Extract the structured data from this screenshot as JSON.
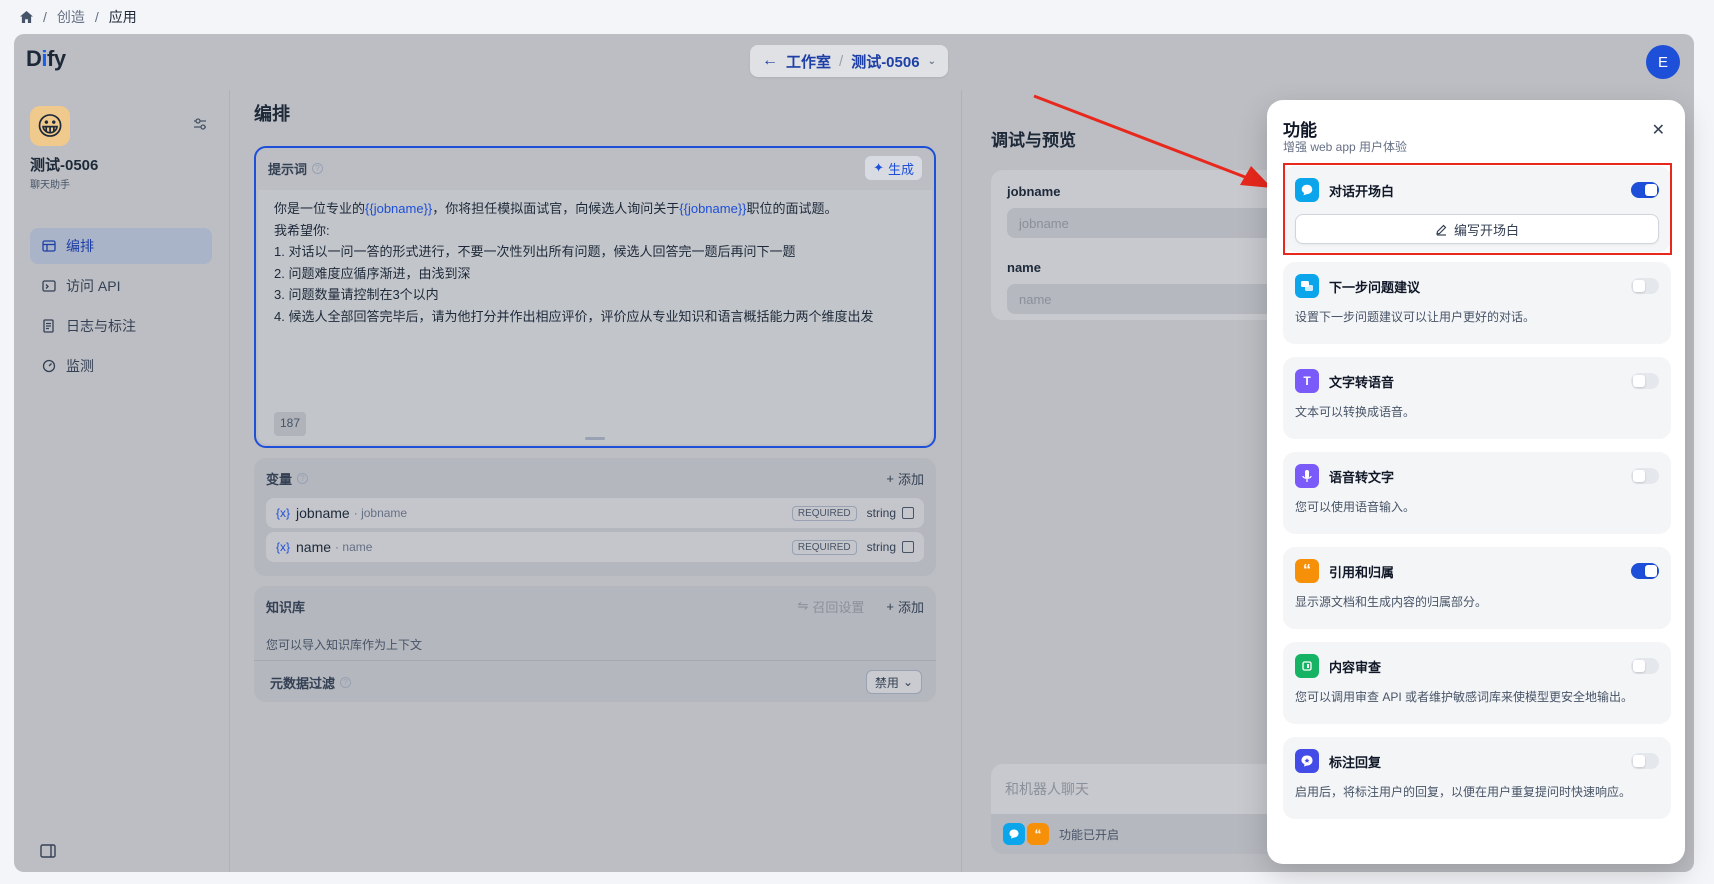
{
  "breadcrumb": {
    "sep": "/",
    "items": [
      "创造",
      "应用"
    ]
  },
  "app": {
    "logo_pre": "D",
    "logo_mid": "i",
    "logo_post": "fy",
    "top_crumb": {
      "studio": "工作室",
      "app": "测试-0506"
    },
    "user_initial": "E"
  },
  "sidebar": {
    "app_name": "测试-0506",
    "app_type": "聊天助手",
    "items": [
      {
        "label": "编排",
        "icon": "layout-icon"
      },
      {
        "label": "访问 API",
        "icon": "terminal-icon"
      },
      {
        "label": "日志与标注",
        "icon": "document-icon"
      },
      {
        "label": "监测",
        "icon": "gauge-icon"
      }
    ]
  },
  "main": {
    "title": "编排",
    "prompt": {
      "label": "提示词",
      "generate": "生成",
      "lines": [
        {
          "a": "你是一位专业的",
          "v1": "{{jobname}}",
          "b": "，你将担任模拟面试官，向候选人询问关于",
          "v2": "{{jobname}}",
          "c": "职位的面试题。"
        },
        "我希望你:",
        "1. 对话以一问一答的形式进行，不要一次性列出所有问题，候选人回答完一题后再问下一题",
        "2. 问题难度应循序渐进，由浅到深",
        "3. 问题数量请控制在3个以内",
        "4. 候选人全部回答完毕后，请为他打分并作出相应评价，评价应从专业知识和语言概括能力两个维度出发"
      ],
      "char_count": "187"
    },
    "variables": {
      "label": "变量",
      "add": "添加",
      "items": [
        {
          "name": "jobname",
          "key": "jobname",
          "required": "REQUIRED",
          "type": "string"
        },
        {
          "name": "name",
          "key": "name",
          "required": "REQUIRED",
          "type": "string"
        }
      ]
    },
    "knowledge": {
      "label": "知识库",
      "recall": "召回设置",
      "add": "添加",
      "desc": "您可以导入知识库作为上下文",
      "metadata_label": "元数据过滤",
      "metadata_value": "禁用"
    }
  },
  "debug": {
    "title": "调试与预览",
    "fields": [
      {
        "label": "jobname",
        "placeholder": "jobname"
      },
      {
        "label": "name",
        "placeholder": "name"
      }
    ],
    "chat_placeholder": "和机器人聊天",
    "features_enabled": "功能已开启"
  },
  "features": {
    "title": "功能",
    "subtitle": "增强 web app 用户体验",
    "items": [
      {
        "name": "对话开场白",
        "desc": "",
        "enabled": true,
        "color": "#0ba5ec",
        "action": "编写开场白"
      },
      {
        "name": "下一步问题建议",
        "desc": "设置下一步问题建议可以让用户更好的对话。",
        "enabled": false,
        "color": "#0ba5ec"
      },
      {
        "name": "文字转语音",
        "desc": "文本可以转换成语音。",
        "enabled": false,
        "color": "#7a5af8"
      },
      {
        "name": "语音转文字",
        "desc": "您可以使用语音输入。",
        "enabled": false,
        "color": "#7a5af8"
      },
      {
        "name": "引用和归属",
        "desc": "显示源文档和生成内容的归属部分。",
        "enabled": true,
        "color": "#f79009"
      },
      {
        "name": "内容审查",
        "desc": "您可以调用审查 API 或者维护敏感词库来使模型更安全地输出。",
        "enabled": false,
        "color": "#16b364"
      },
      {
        "name": "标注回复",
        "desc": "启用后，将标注用户的回复，以便在用户重复提问时快速响应。",
        "enabled": false,
        "color": "#444ce7"
      }
    ]
  },
  "colors": {
    "primary": "#1d4fd8",
    "annotation": "#e8281c"
  }
}
